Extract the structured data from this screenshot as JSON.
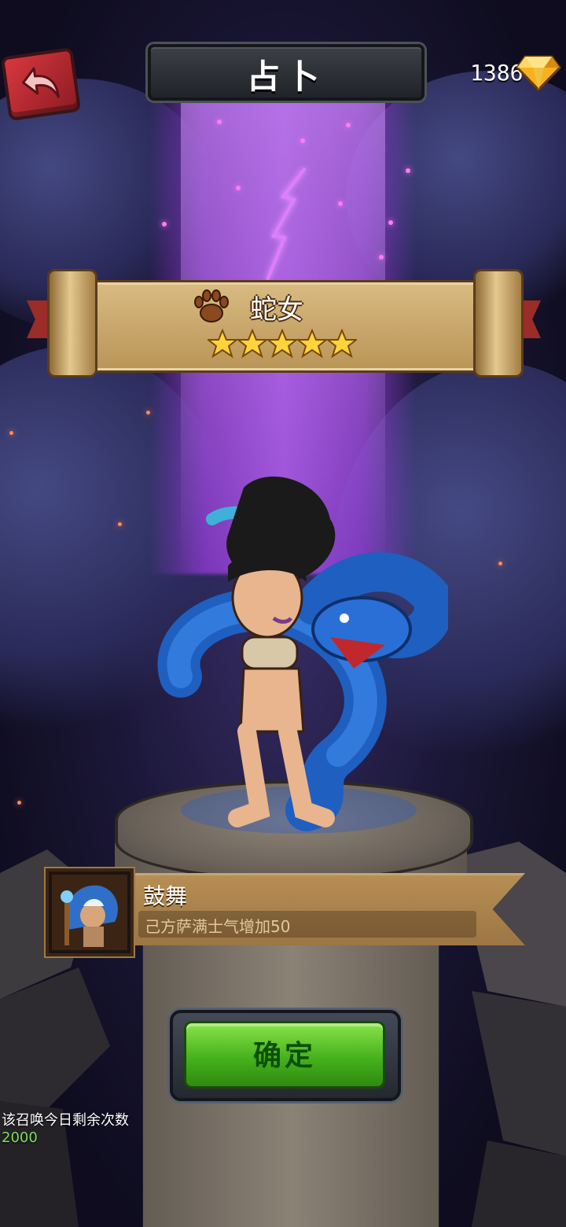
{
  "header": {
    "title": "占卜",
    "gem_count": "1386",
    "back_icon": "back-arrow-icon",
    "gem_icon": "diamond-gem-icon"
  },
  "hero": {
    "name": "蛇女",
    "class_icon": "paw-icon",
    "stars": 5,
    "max_stars": 5
  },
  "skill": {
    "name": "鼓舞",
    "description": "己方萨满士气增加50",
    "icon": "shaman-portrait-icon"
  },
  "confirm": {
    "label": "确定"
  },
  "summon_info": {
    "label": "该召唤今日剩余次数",
    "value": "2000"
  },
  "colors": {
    "beam": "#b05cf0",
    "confirm_green": "#45b21c",
    "remaining_value": "#7de05a"
  }
}
